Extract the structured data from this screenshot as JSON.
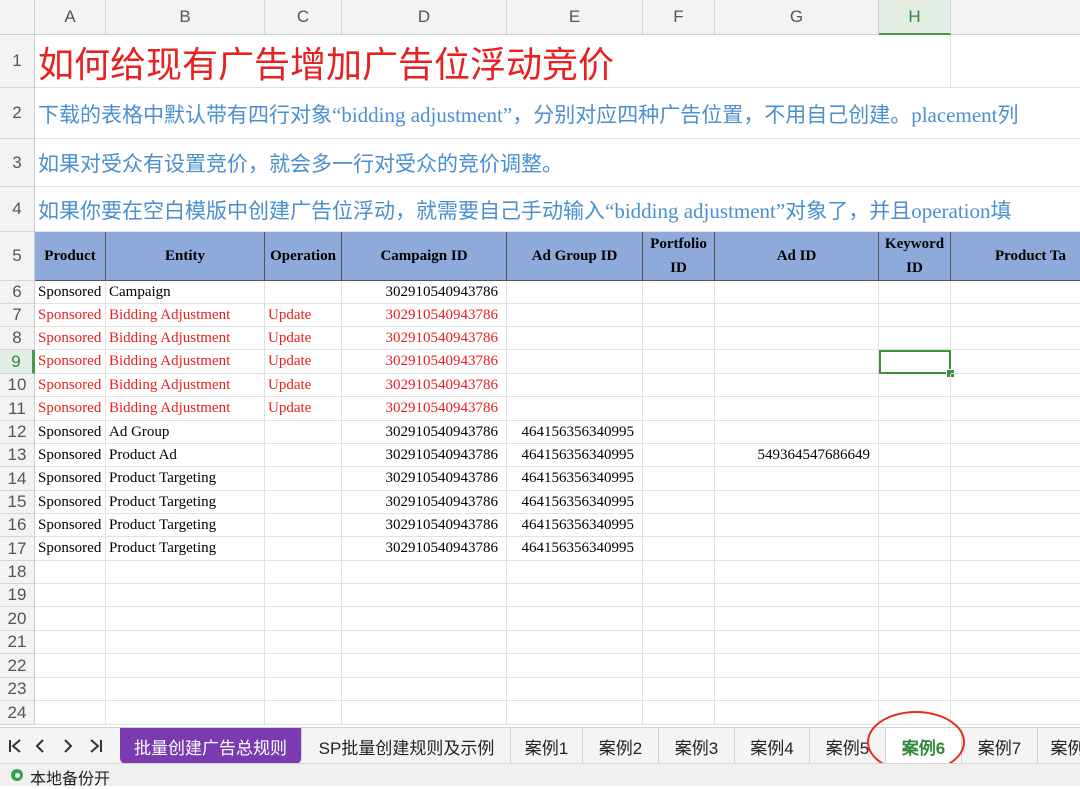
{
  "columns": [
    "A",
    "B",
    "C",
    "D",
    "E",
    "F",
    "G",
    "H",
    ""
  ],
  "selected_column": "H",
  "rows": [
    "1",
    "2",
    "3",
    "4",
    "5",
    "6",
    "7",
    "8",
    "9",
    "10",
    "11",
    "12",
    "13",
    "14",
    "15",
    "16",
    "17",
    "18",
    "19",
    "20",
    "21",
    "22",
    "23",
    "24"
  ],
  "selected_row": "9",
  "title": "如何给现有广告增加广告位浮动竞价",
  "notes": [
    "下载的表格中默认带有四行对象“bidding adjustment”，分别对应四种广告位置，不用自己创建。placement列",
    "如果对受众有设置竞价，就会多一行对受众的竞价调整。",
    "如果你要在空白模版中创建广告位浮动，就需要自己手动输入“bidding adjustment”对象了，并且operation填"
  ],
  "table_headers": [
    "Product",
    "Entity",
    "Operation",
    "Campaign ID",
    "Ad Group ID",
    "Portfolio ID",
    "Ad ID",
    "Keyword ID",
    "Product Ta"
  ],
  "table_rows": [
    {
      "product": "Sponsored",
      "entity": "Campaign",
      "operation": "",
      "campaign_id": "302910540943786",
      "ad_group_id": "",
      "ad_id": "",
      "red": false
    },
    {
      "product": "Sponsored",
      "entity": "Bidding Adjustment",
      "operation": "Update",
      "campaign_id": "302910540943786",
      "ad_group_id": "",
      "ad_id": "",
      "red": true
    },
    {
      "product": "Sponsored",
      "entity": "Bidding Adjustment",
      "operation": "Update",
      "campaign_id": "302910540943786",
      "ad_group_id": "",
      "ad_id": "",
      "red": true
    },
    {
      "product": "Sponsored",
      "entity": "Bidding Adjustment",
      "operation": "Update",
      "campaign_id": "302910540943786",
      "ad_group_id": "",
      "ad_id": "",
      "red": true
    },
    {
      "product": "Sponsored",
      "entity": "Bidding Adjustment",
      "operation": "Update",
      "campaign_id": "302910540943786",
      "ad_group_id": "",
      "ad_id": "",
      "red": true
    },
    {
      "product": "Sponsored",
      "entity": "Bidding Adjustment",
      "operation": "Update",
      "campaign_id": "302910540943786",
      "ad_group_id": "",
      "ad_id": "",
      "red": true
    },
    {
      "product": "Sponsored",
      "entity": "Ad Group",
      "operation": "",
      "campaign_id": "302910540943786",
      "ad_group_id": "464156356340995",
      "ad_id": "",
      "red": false
    },
    {
      "product": "Sponsored",
      "entity": "Product Ad",
      "operation": "",
      "campaign_id": "302910540943786",
      "ad_group_id": "464156356340995",
      "ad_id": "549364547686649",
      "red": false
    },
    {
      "product": "Sponsored",
      "entity": "Product Targeting",
      "operation": "",
      "campaign_id": "302910540943786",
      "ad_group_id": "464156356340995",
      "ad_id": "",
      "red": false
    },
    {
      "product": "Sponsored",
      "entity": "Product Targeting",
      "operation": "",
      "campaign_id": "302910540943786",
      "ad_group_id": "464156356340995",
      "ad_id": "",
      "red": false
    },
    {
      "product": "Sponsored",
      "entity": "Product Targeting",
      "operation": "",
      "campaign_id": "302910540943786",
      "ad_group_id": "464156356340995",
      "ad_id": "",
      "red": false
    },
    {
      "product": "Sponsored",
      "entity": "Product Targeting",
      "operation": "",
      "campaign_id": "302910540943786",
      "ad_group_id": "464156356340995",
      "ad_id": "",
      "red": false
    }
  ],
  "nav_buttons": [
    "K",
    "<",
    ">",
    "K"
  ],
  "sheet_tabs": [
    "批量创建广告总规则",
    "SP批量创建规则及示例",
    "案例1",
    "案例2",
    "案例3",
    "案例4",
    "案例5",
    "案例6",
    "案例7",
    "案例"
  ],
  "active_tab": "案例6",
  "status_text": "本地备份开",
  "colors": {
    "header_fill": "#8eaadb",
    "red_text": "#e8201f",
    "blue_text": "#4a8fd0",
    "purple_tab": "#7b3bb0",
    "active_green": "#2f8a3c"
  }
}
